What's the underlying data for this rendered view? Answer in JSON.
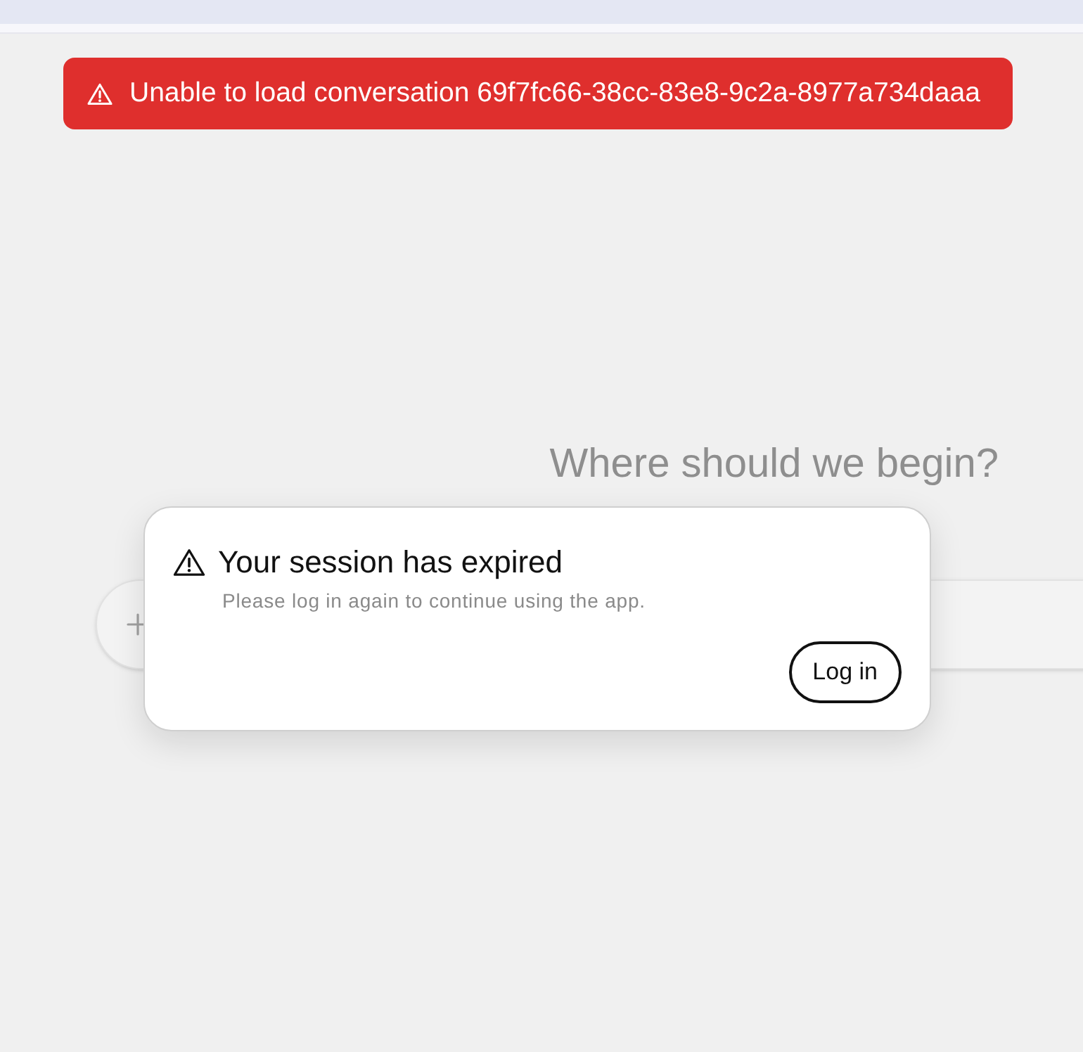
{
  "error_banner": {
    "message": "Unable to load conversation 69f7fc66-38cc-83e8-9c2a-8977a734daaa"
  },
  "background": {
    "heading": "Where should we begin?"
  },
  "dialog": {
    "title": "Your session has expired",
    "message": "Please log in again to continue using the app.",
    "button": "Log in"
  }
}
